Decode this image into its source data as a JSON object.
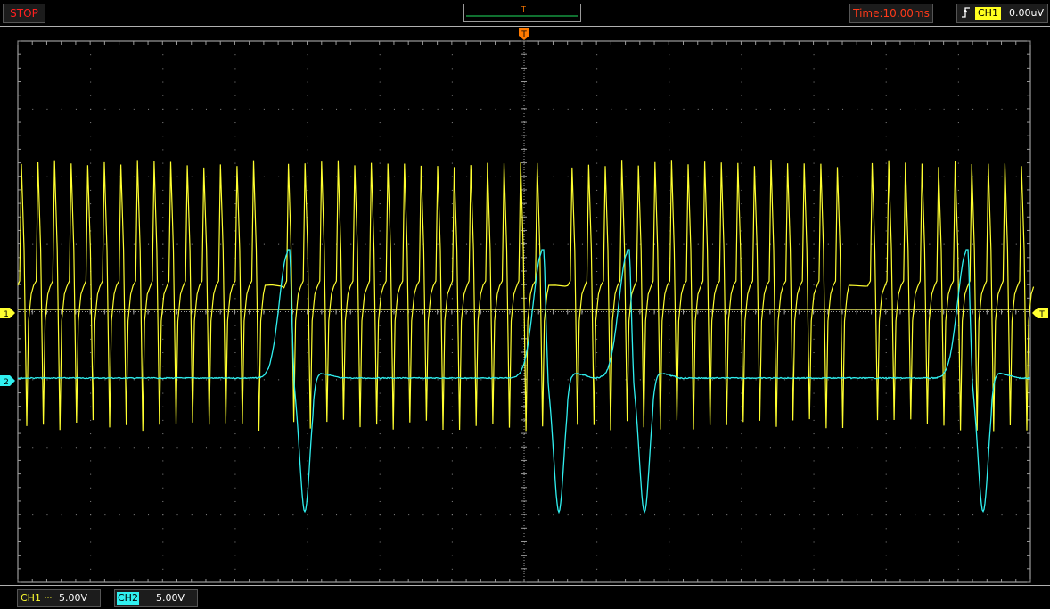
{
  "toolbar": {
    "run_state": "STOP",
    "overview_trigger_mark": "T",
    "timebase": "Time:10.00ms",
    "trigger": {
      "channel": "CH1",
      "level": "0.00uV",
      "edge_icon": "rising-edge-icon"
    }
  },
  "screen": {
    "trigger_position_mark": "T",
    "trigger_level_mark": "T",
    "ch1_marker": "1",
    "ch2_marker": "2"
  },
  "channels": [
    {
      "label": "CH1",
      "coupling": "⎓",
      "scale": "5.00V",
      "color": "#ffff30"
    },
    {
      "label": "CH2",
      "coupling": "⎓",
      "scale": "5.00V",
      "color": "#30f0f0"
    }
  ],
  "colors": {
    "ch1": "#ffff30",
    "ch2": "#30f0f0",
    "trigger": "#ff7a00",
    "grid": "#9a9a9a",
    "run_state": "#ff2020"
  },
  "chart_data": {
    "type": "line",
    "grid": {
      "h_div": 14,
      "v_div": 8
    },
    "series": [
      {
        "channel": "CH1",
        "kind": "spike-train",
        "spike_count": 58,
        "burst_gaps_after_spike": [
          15,
          31,
          48
        ]
      },
      {
        "channel": "CH2",
        "kind": "slow-wave",
        "pulse_count": 4
      }
    ]
  }
}
